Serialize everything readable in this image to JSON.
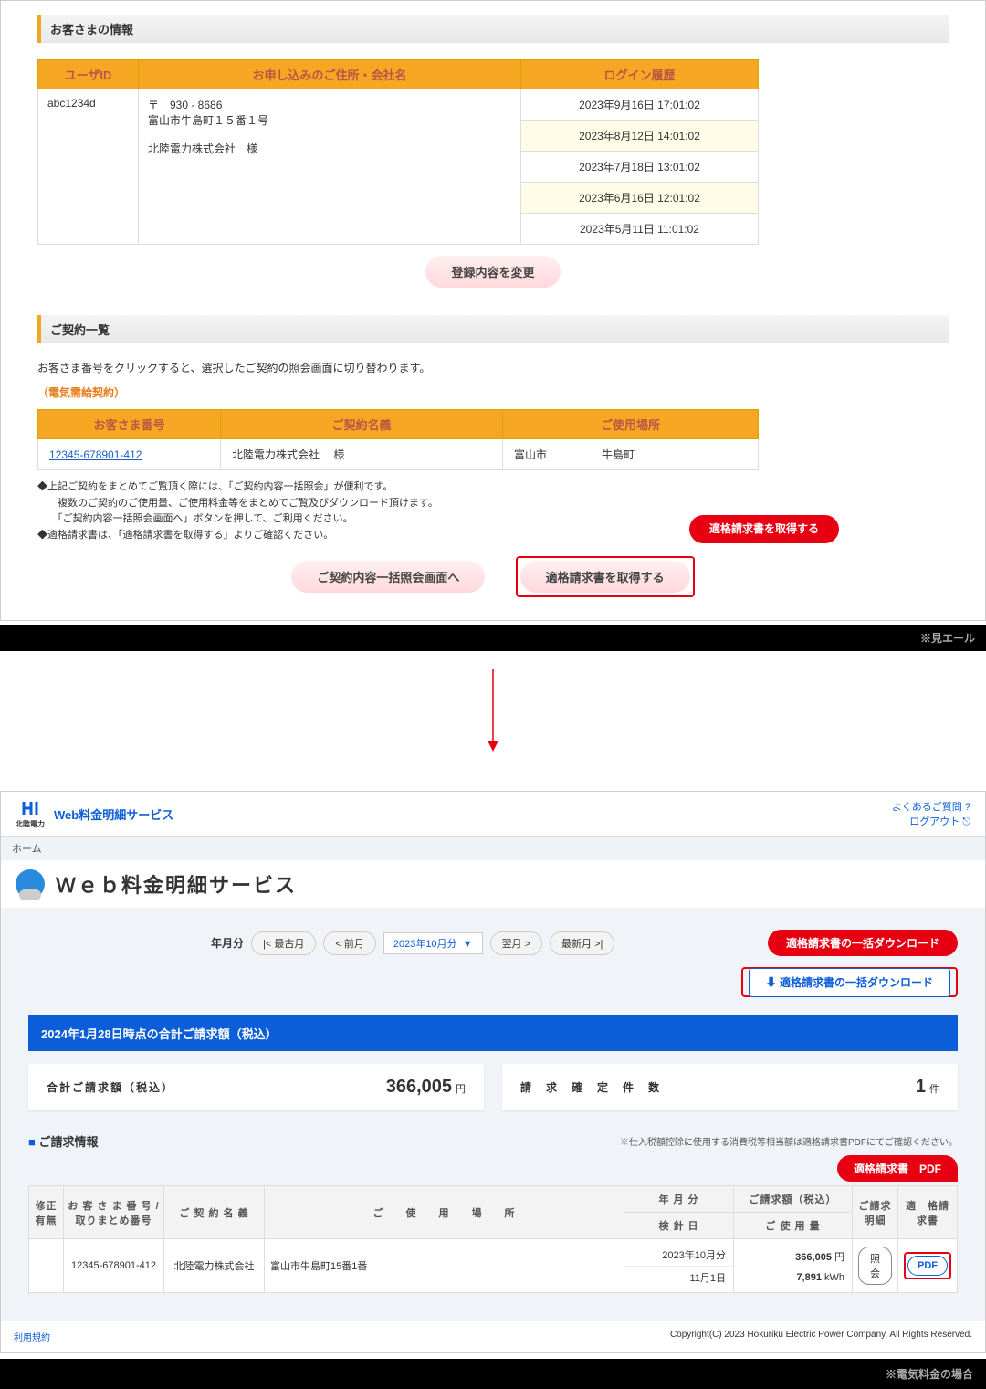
{
  "top": {
    "sec_customer": "お客さまの情報",
    "headers": {
      "user_id": "ユーザID",
      "address": "お申し込みのご住所・会社名",
      "login_history": "ログイン履歴"
    },
    "user_id": "abc1234d",
    "postal_prefix": "〒　930 - 8686",
    "address1": "富山市牛島町１５番１号",
    "company": "北陸電力株式会社　様",
    "logins": [
      {
        "t": "2023年9月16日  17:01:02",
        "alt": false
      },
      {
        "t": "2023年8月12日  14:01:02",
        "alt": true
      },
      {
        "t": "2023年7月18日  13:01:02",
        "alt": false
      },
      {
        "t": "2023年6月16日  12:01:02",
        "alt": true
      },
      {
        "t": "2023年5月11日  11:01:02",
        "alt": false
      }
    ],
    "change_btn": "登録内容を変更",
    "sec_contracts": "ご契約一覧",
    "desc": "お客さま番号をクリックすると、選択したご契約の照会画面に切り替わります。",
    "supply_label": "（電気需給契約）",
    "c_headers": {
      "cust_no": "お客さま番号",
      "c_name": "ご契約名義",
      "c_place": "ご使用場所"
    },
    "c_cust_no": "12345-678901-412",
    "c_name": "北陸電力株式会社　 様",
    "c_place": "富山市　　　　　牛島町",
    "notes1": "◆上記ご契約をまとめてご覧頂く際には、「ご契約内容一括照会」が便利です。",
    "notes2": "　　複数のご契約のご使用量、ご使用料金等をまとめてご覧及びダウンロード頂けます。",
    "notes3": "　　「ご契約内容一括照会画面へ」ボタンを押して、ご利用ください。",
    "notes4": "◆適格請求書は、「適格請求書を取得する」よりご確認ください。",
    "callout": "適格請求書を取得する",
    "btn_batch": "ご契約内容一括照会画面へ",
    "btn_invoice": "適格請求書を取得する"
  },
  "mieru": "※見エール",
  "svc": {
    "brand_small": "北陸電力",
    "title": "Web料金明細サービス",
    "faq": "よくあるご質問 ?",
    "logout": "ログアウト ⎋",
    "crumb": "ホーム",
    "h1": "Ｗｅｂ料金明細サービス",
    "period_label": "年月分",
    "btn_oldest": "|< 最古月",
    "btn_prev": "< 前月",
    "period_value": "2023年10月分",
    "btn_next": "翌月 >",
    "btn_latest": "最新月 >|",
    "callout_dl": "適格請求書の一括ダウンロード",
    "dl_btn": "適格請求書の一括ダウンロード",
    "blue_bar": "2024年1月28日時点の合計ご請求額（税込）",
    "sum_label": "合計ご請求額（税込）",
    "sum_value": "366,005",
    "sum_unit": "円",
    "count_label": "請　求　確　定　件　数",
    "count_value": "1",
    "count_unit": "件",
    "sec_billing": "ご請求情報",
    "billing_note": "※仕入税額控除に使用する消費税等相当額は適格請求書PDFにてご確認ください。",
    "callout_pdf": "適格請求書　PDF",
    "th": {
      "correction": "修正有無",
      "cust_no": "お 客 さ ま 番 号 /取りまとめ番号",
      "c_name": "ご 契 約 名 義",
      "place": "ご　　使　　用　　場　　所",
      "ym": "年 月 分",
      "amount": "ご請求額（税込）",
      "meter": "検 針 日",
      "usage": "ご 使 用 量",
      "detail": "ご請求明細",
      "invoice": "適　格請求書"
    },
    "row": {
      "cust_no": "12345-678901-412",
      "c_name": "北陸電力株式会社",
      "place": "富山市牛島町15番1番",
      "ym": "2023年10月分",
      "amount_v": "366,005",
      "amount_u": "円",
      "meter": "11月1日",
      "usage_v": "7,891",
      "usage_u": "kWh",
      "detail_btn": "照会",
      "pdf_btn": "PDF"
    },
    "terms": "利用規約",
    "copyright": "Copyright(C) 2023 Hokuriku Electric Power Company. All Rights Reserved."
  },
  "elec_note": "※電気料金の場合"
}
